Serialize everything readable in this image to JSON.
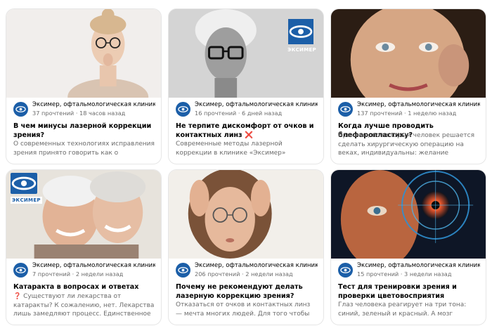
{
  "colors": {
    "brand": "#1c5fa8",
    "muted": "#6b6b6b",
    "border": "#e6e6e6"
  },
  "logo_text": "ЭКСИМЕР",
  "cards": [
    {
      "channel": "Эксимер, офтальмологическая клиника",
      "stats": "37 прочтений · 18 часов назад",
      "title": "В чем минусы лазерной коррекции зрения?",
      "snippet": "О современных технологиях исправления зрения принято говорить как о вершине...",
      "image": "woman-with-glasses-thinking"
    },
    {
      "channel": "Эксимер, офтальмологическая клиника",
      "stats": "16 прочтений · 6 дней назад",
      "title": "Не терпите дискомфорт от очков и контактных линз ❌",
      "snippet": "Современные методы лазерной коррекции в клинике «Эксимер» способны быстро и...",
      "image": "woman-in-glasses-bw"
    },
    {
      "channel": "Эксимер, офтальмологическая клиника",
      "stats": "137 прочтений · 1 неделю назад",
      "title": "Когда лучше проводить блефаропластику?",
      "snippet": "Причины, по которым человек решается сделать хирургическую операцию на веках, индивидуальны: желание выглядеть моло...",
      "image": "mature-woman-face"
    },
    {
      "channel": "Эксимер, офтальмологическая клиника",
      "stats": "7 прочтений · 2 недели назад",
      "title": "Катаракта в вопросах и ответах",
      "snippet": "❓ Существуют ли лекарства от катаракты? К сожалению, нет. Лекарства лишь замедляют процесс. Единственное решение - операци...",
      "image": "elderly-couple"
    },
    {
      "channel": "Эксимер, офтальмологическая клиника",
      "stats": "206 прочтений · 2 недели назад",
      "title": "Почему не рекомендуют делать лазерную коррекцию зрения?",
      "snippet": "Отказаться от очков и контактных линз — мечта многих людей. Для того чтобы она...",
      "image": "woman-stressed-glasses"
    },
    {
      "channel": "Эксимер, офтальмологическая клиника",
      "stats": "15 прочтений · 3 недели назад",
      "title": "Тест для тренировки зрения и проверки цветовосприятия",
      "snippet": "Глаз человека реагирует на три тона: синий, зеленый и красный. А мозг воспринимает...",
      "image": "eye-digital-scan"
    }
  ]
}
